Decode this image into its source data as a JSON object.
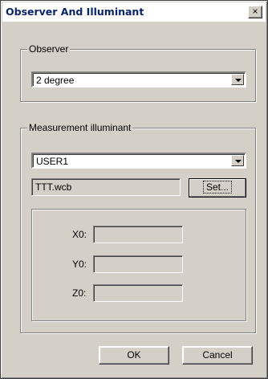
{
  "window": {
    "title": "Observer And Illuminant",
    "close_glyph": "×"
  },
  "observer": {
    "legend": "Observer",
    "selected": "2 degree"
  },
  "illuminant": {
    "legend": "Measurement illuminant",
    "selected": "USER1",
    "file": "TTT.wcb",
    "set_label": "Set..."
  },
  "xyz": {
    "x_label": "X0:",
    "y_label": "Y0:",
    "z_label": "Z0:",
    "x_value": "",
    "y_value": "",
    "z_value": ""
  },
  "buttons": {
    "ok_label": "OK",
    "cancel_label": "Cancel"
  },
  "icons": {
    "close": "close-icon",
    "dropdown": "chevron-down-icon"
  }
}
